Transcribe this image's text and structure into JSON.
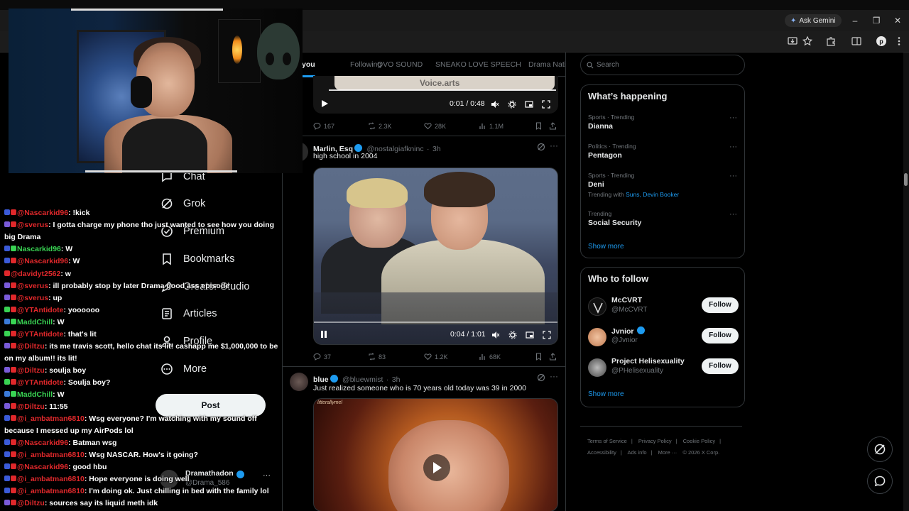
{
  "browser": {
    "gemini_label": "Ask Gemini",
    "minimize": "–",
    "restore": "❐",
    "close": "✕"
  },
  "tabs": [
    {
      "label": "you",
      "active": true
    },
    {
      "label": "Following",
      "active": false
    },
    {
      "label": "OVO SOUND",
      "active": false
    },
    {
      "label": "SNEAKO LOVE SPEECH",
      "active": false
    },
    {
      "label": "Drama Nati",
      "active": false
    }
  ],
  "feed": {
    "top_video": {
      "ghost_text": "Voice.arts",
      "time": "0:01 / 0:48"
    },
    "top_actions": {
      "replies": "167",
      "reposts": "2.3K",
      "likes": "28K",
      "views": "1.1M"
    },
    "tweet1": {
      "name": "Marlin, Esq",
      "handle": "@nostalgiafkninc",
      "time": "3h",
      "text": "high school in 2004",
      "video_time": "0:04 / 1:01",
      "actions": {
        "replies": "37",
        "reposts": "83",
        "likes": "1.2K",
        "views": "68K"
      }
    },
    "tweet2": {
      "name": "blue",
      "handle": "@bluewmist",
      "time": "3h",
      "text": "Just realized someone who is 70 years old today was 39 in 2000",
      "media_watermark": "litterallymel"
    }
  },
  "nav": {
    "chat": "Chat",
    "grok": "Grok",
    "premium": "Premium",
    "bookmarks": "Bookmarks",
    "creator_studio": "Creator Studio",
    "articles": "Articles",
    "profile": "Profile",
    "more": "More",
    "post": "Post",
    "account_name": "Dramathadon",
    "account_handle": "@Drama_586"
  },
  "chat": [
    {
      "user": "@Nascarkid96",
      "text": ": !kick",
      "user_color": "#e0282b",
      "badges": [
        "#3b5bd9",
        "#e0282b"
      ]
    },
    {
      "user": "@sverus",
      "text": ": I gotta charge my phone tho just wanted to see how you doing big Drama",
      "user_color": "#e0282b",
      "badges": [
        "#7a5bd9",
        "#e0282b"
      ]
    },
    {
      "user": "Nascarkid96",
      "text": ": W",
      "user_color": "#39d353",
      "badges": [
        "#3b5bd9",
        "#39d353"
      ]
    },
    {
      "user": "@Nascarkid96",
      "text": ": W",
      "user_color": "#e0282b",
      "badges": [
        "#3b5bd9",
        "#e0282b"
      ]
    },
    {
      "user": "@davidyt2562",
      "text": ": w",
      "user_color": "#e0282b",
      "badges": [
        "#e0282b"
      ]
    },
    {
      "user": "@sverus",
      "text": ": ill probably stop by later Drama good ass episode",
      "user_color": "#e0282b",
      "badges": [
        "#7a5bd9",
        "#e0282b"
      ]
    },
    {
      "user": "@sverus",
      "text": ": up",
      "user_color": "#e0282b",
      "badges": [
        "#7a5bd9",
        "#e0282b"
      ]
    },
    {
      "user": "@YTAntidote",
      "text": ": yoooooo",
      "user_color": "#e0282b",
      "badges": [
        "#39d353",
        "#e0282b"
      ]
    },
    {
      "user": "MaddChill",
      "text": ": W",
      "user_color": "#39d353",
      "badges": [
        "#3b7bd9",
        "#39d353"
      ]
    },
    {
      "user": "@YTAntidote",
      "text": ": that's lit",
      "user_color": "#e0282b",
      "badges": [
        "#39d353",
        "#e0282b"
      ]
    },
    {
      "user": "@Diltzu",
      "text": ": its me travis scott, hello chat its lit! cashapp me $1,000,000 to be on my album!! its lit!",
      "user_color": "#e0282b",
      "badges": [
        "#7a5bd9",
        "#e0282b"
      ]
    },
    {
      "user": "@Diltzu",
      "text": ": soulja boy",
      "user_color": "#e0282b",
      "badges": [
        "#7a5bd9",
        "#e0282b"
      ]
    },
    {
      "user": "@YTAntidote",
      "text": ": Soulja boy?",
      "user_color": "#e0282b",
      "badges": [
        "#39d353",
        "#e0282b"
      ]
    },
    {
      "user": "MaddChill",
      "text": ": W",
      "user_color": "#39d353",
      "badges": [
        "#3b7bd9",
        "#39d353"
      ]
    },
    {
      "user": "@Diltzu",
      "text": ": 11:55",
      "user_color": "#e0282b",
      "badges": [
        "#7a5bd9",
        "#e0282b"
      ]
    },
    {
      "user": "@i_ambatman6810",
      "text": ": Wsg everyone? I'm watching with my sound off because I messed up my AirPods lol",
      "user_color": "#e0282b",
      "badges": [
        "#3b5bd9",
        "#e0282b"
      ]
    },
    {
      "user": "@Nascarkid96",
      "text": ": Batman wsg",
      "user_color": "#e0282b",
      "badges": [
        "#3b5bd9",
        "#e0282b"
      ]
    },
    {
      "user": "@i_ambatman6810",
      "text": ": Wsg NASCAR. How's it going?",
      "user_color": "#e0282b",
      "badges": [
        "#3b5bd9",
        "#e0282b"
      ]
    },
    {
      "user": "@Nascarkid96",
      "text": ": good hbu",
      "user_color": "#e0282b",
      "badges": [
        "#3b5bd9",
        "#e0282b"
      ]
    },
    {
      "user": "@i_ambatman6810",
      "text": ": Hope everyone is doing well",
      "user_color": "#e0282b",
      "badges": [
        "#3b5bd9",
        "#e0282b"
      ]
    },
    {
      "user": "@i_ambatman6810",
      "text": ": I'm doing ok. Just chilling in bed with the family lol",
      "user_color": "#e0282b",
      "badges": [
        "#3b5bd9",
        "#e0282b"
      ]
    },
    {
      "user": "@Diltzu",
      "text": ": sources say its liquid meth idk",
      "user_color": "#e0282b",
      "badges": [
        "#7a5bd9",
        "#e0282b"
      ]
    }
  ],
  "sidebar_right": {
    "search_placeholder": "Search",
    "whats_happening": "What’s happening",
    "trends": [
      {
        "category": "Sports · Trending",
        "title": "Dianna",
        "with": ""
      },
      {
        "category": "Politics · Trending",
        "title": "Pentagon",
        "with": ""
      },
      {
        "category": "Sports · Trending",
        "title": "Deni",
        "with_prefix": "Trending with",
        "with": "Suns, Devin Booker"
      },
      {
        "category": "Trending",
        "title": "Social Security",
        "with": ""
      }
    ],
    "show_more": "Show more",
    "who_to_follow": "Who to follow",
    "follow_suggestions": [
      {
        "name": "McCVRT",
        "handle": "@McCVRT",
        "verified": false
      },
      {
        "name": "Jvnior",
        "handle": "@Jvnior",
        "verified": true
      },
      {
        "name": "Project Helisexuality",
        "handle": "@PHelisexuality",
        "verified": false
      }
    ],
    "follow_label": "Follow",
    "show_more_2": "Show more",
    "footer": {
      "terms": "Terms of Service",
      "privacy": "Privacy Policy",
      "cookie": "Cookie Policy",
      "accessibility": "Accessibility",
      "ads": "Ads info",
      "more": "More ···",
      "copyright": "© 2026 X Corp."
    }
  },
  "colors": {
    "accent": "#1d9bf0",
    "background": "#000000",
    "border": "#2f3336",
    "muted": "#71767b"
  }
}
